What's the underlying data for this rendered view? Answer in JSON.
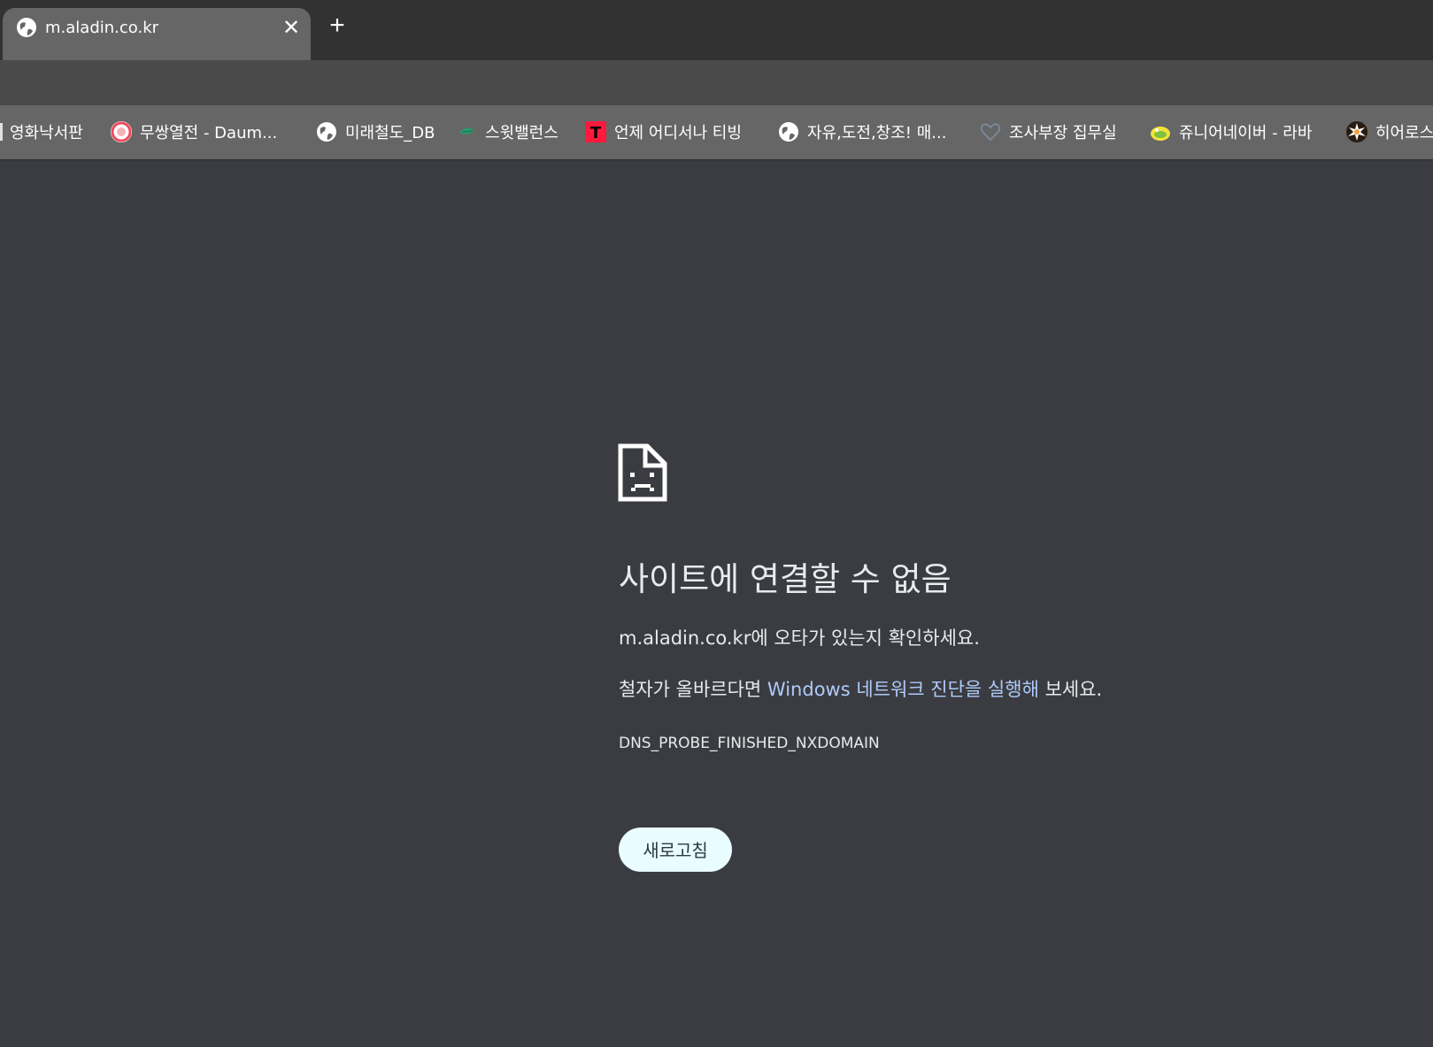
{
  "browser": {
    "tab": {
      "title": "m.aladin.co.kr",
      "favicon": "globe-icon",
      "close": "✕"
    },
    "new_tab": "+",
    "bookmarks": [
      {
        "label": "영화낙서판",
        "icon": "none"
      },
      {
        "label": "무쌍열전 - Daum...",
        "icon": "cafe-icon"
      },
      {
        "label": "미래철도_DB",
        "icon": "globe-icon"
      },
      {
        "label": "스윗밸런스",
        "icon": "leaf-icon"
      },
      {
        "label": "언제 어디서나 티빙",
        "icon": "tving-icon"
      },
      {
        "label": "자유,도전,창조! 매...",
        "icon": "globe-icon"
      },
      {
        "label": "조사부장 집무실",
        "icon": "heart-icon"
      },
      {
        "label": "쥬니어네이버 - 라바",
        "icon": "larva-icon"
      },
      {
        "label": "히어로스",
        "icon": "burst-icon"
      }
    ]
  },
  "error": {
    "icon": "sad-document-icon",
    "heading": "사이트에 연결할 수 없음",
    "line1": "m.aladin.co.kr에 오타가 있는지 확인하세요.",
    "line2_prefix": "철자가 올바르다면 ",
    "line2_link": "Windows 네트워크 진단을 실행해",
    "line2_suffix": " 보세요.",
    "code": "DNS_PROBE_FINISHED_NXDOMAIN",
    "reload_button": "새로고침"
  },
  "colors": {
    "page_background": "#3b3c41",
    "tab_active": "#666666",
    "link": "#aecbfa",
    "button_background": "#e9fcff"
  }
}
